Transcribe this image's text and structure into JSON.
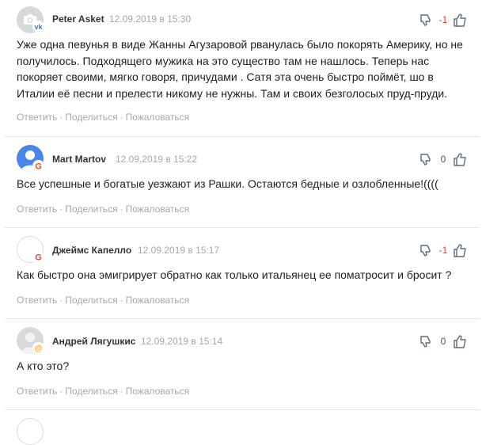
{
  "comments": [
    {
      "author": "Peter Asket",
      "date": "12.09.2019 в 15:30",
      "avatar_icon": "camera-placeholder-icon",
      "badge_icon": "vk-icon",
      "text": "Уже одна певунья в виде Жанны Агузаровой рванулась было покорять Америку, но не получилось. Подходящего мужика на это существо там не нашлось. Теперь нас покоряет своими, мягко говоря, причудами . Сатя эта очень быстро поймёт, шо в Италии её песни и прелести никому не нужны. Там и своих безголосых пруд-пруди.",
      "score": "-1"
    },
    {
      "author": "Mart Martov",
      "date": "12.09.2019 в 15:22",
      "avatar_icon": "user-silhouette-icon",
      "badge_icon": "google-icon",
      "text": "Все успешные и богатые уезжают из Рашки. Остаются бедные и озлобленные!((((",
      "score": "0"
    },
    {
      "author": "Джеймс Капелло",
      "date": "12.09.2019 в 15:17",
      "avatar_icon": "blank-avatar",
      "badge_icon": "google-icon",
      "text": "Как быстро она эмигрирует обратно как только итальянец ее поматросит и бросит ?",
      "score": "-1"
    },
    {
      "author": "Андрей Лягушкис",
      "date": "12.09.2019 в 15:14",
      "avatar_icon": "user-silhouette-icon",
      "badge_icon": "mail-at-icon",
      "text": "А кто это?",
      "score": "0"
    }
  ],
  "actions": {
    "reply": "Ответить",
    "share": "Поделиться",
    "report": "Пожаловаться",
    "separator": "·"
  },
  "colors": {
    "negative_score": "#e0453a",
    "muted_text": "#a8a8a8",
    "vote_icon": "#5b6b7a"
  }
}
